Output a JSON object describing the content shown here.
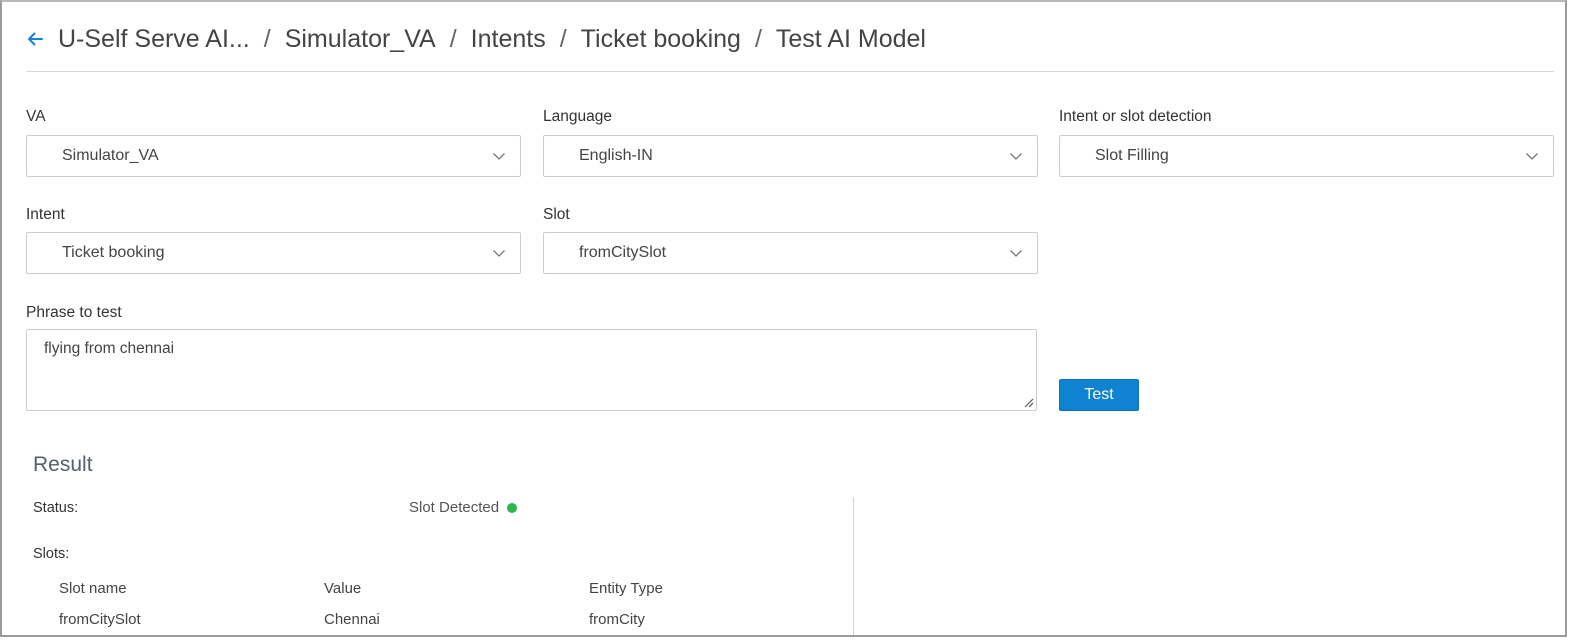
{
  "breadcrumb": {
    "items": [
      "U-Self Serve AI...",
      "Simulator_VA",
      "Intents",
      "Ticket booking",
      "Test AI Model"
    ],
    "separator": "/"
  },
  "form": {
    "va": {
      "label": "VA",
      "value": "Simulator_VA"
    },
    "language": {
      "label": "Language",
      "value": "English-IN"
    },
    "detection": {
      "label": "Intent or slot detection",
      "value": "Slot Filling"
    },
    "intent": {
      "label": "Intent",
      "value": "Ticket booking"
    },
    "slot": {
      "label": "Slot",
      "value": "fromCitySlot"
    },
    "phrase": {
      "label": "Phrase to test",
      "value": "flying from chennai"
    },
    "test_button": "Test"
  },
  "result": {
    "title": "Result",
    "status_label": "Status:",
    "status_value": "Slot Detected",
    "slots_label": "Slots:",
    "columns": [
      "Slot name",
      "Value",
      "Entity Type"
    ],
    "rows": [
      [
        "fromCitySlot",
        "Chennai",
        "fromCity"
      ]
    ]
  },
  "colors": {
    "accent": "#0f82d1",
    "status_ok": "#2db64a"
  },
  "icons": {
    "back": "arrow-left-icon",
    "dropdown": "chevron-down-icon",
    "status": "status-dot-icon"
  }
}
